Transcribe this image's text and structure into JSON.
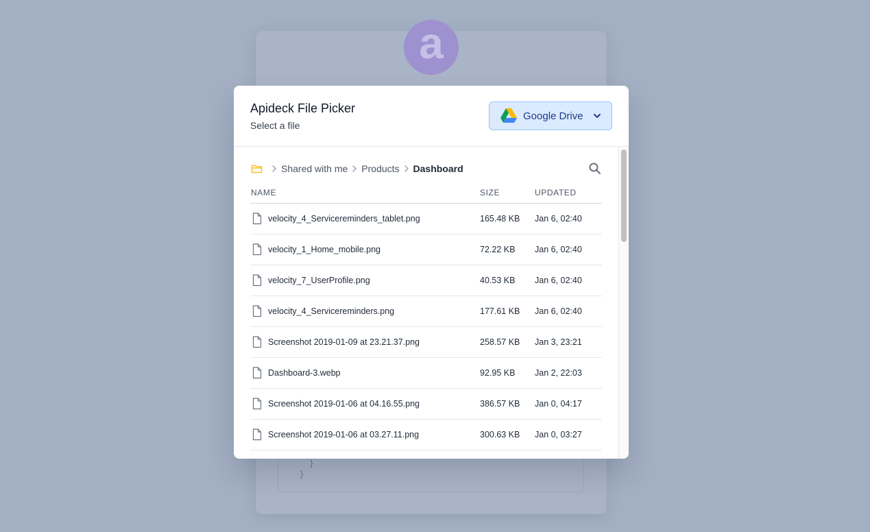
{
  "background": {
    "logo_letter": "a",
    "code_lines": "    }\n  }"
  },
  "modal": {
    "title": "Apideck File Picker",
    "subtitle": "Select a file",
    "provider": {
      "label": "Google Drive",
      "icon": "google-drive-icon"
    }
  },
  "breadcrumb": {
    "items": [
      "Shared with me",
      "Products",
      "Dashboard"
    ]
  },
  "table": {
    "headers": {
      "name": "NAME",
      "size": "SIZE",
      "updated": "UPDATED"
    },
    "rows": [
      {
        "name": "velocity_4_Servicereminders_tablet.png",
        "size": "165.48 KB",
        "updated": "Jan 6, 02:40"
      },
      {
        "name": "velocity_1_Home_mobile.png",
        "size": "72.22 KB",
        "updated": "Jan 6, 02:40"
      },
      {
        "name": "velocity_7_UserProfile.png",
        "size": "40.53 KB",
        "updated": "Jan 6, 02:40"
      },
      {
        "name": "velocity_4_Servicereminders.png",
        "size": "177.61 KB",
        "updated": "Jan 6, 02:40"
      },
      {
        "name": "Screenshot 2019-01-09 at 23.21.37.png",
        "size": "258.57 KB",
        "updated": "Jan 3, 23:21"
      },
      {
        "name": "Dashboard-3.webp",
        "size": "92.95 KB",
        "updated": "Jan 2, 22:03"
      },
      {
        "name": "Screenshot 2019-01-06 at 04.16.55.png",
        "size": "386.57 KB",
        "updated": "Jan 0, 04:17"
      },
      {
        "name": "Screenshot 2019-01-06 at 03.27.11.png",
        "size": "300.63 KB",
        "updated": "Jan 0, 03:27"
      }
    ]
  },
  "colors": {
    "overlay": "#a3afc2",
    "accent_bg": "#dbeafe",
    "accent_text": "#1e3a8a",
    "folder": "#fbbf24"
  }
}
